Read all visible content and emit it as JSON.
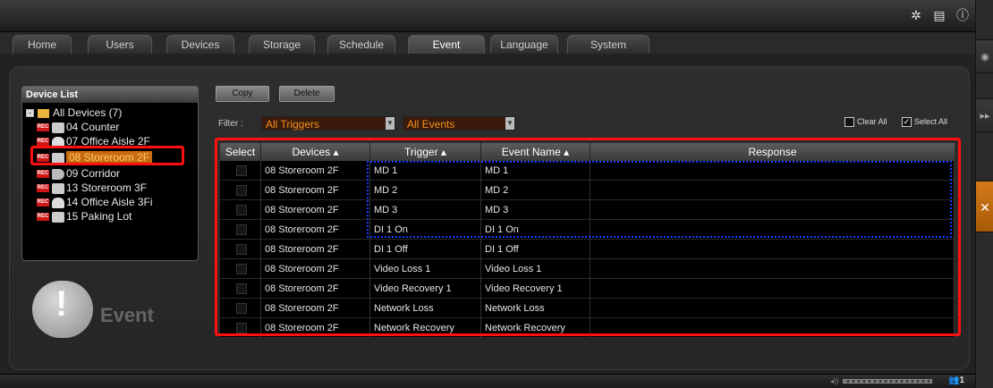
{
  "header": {
    "icons": [
      "gear-icon",
      "document-icon",
      "info-icon"
    ]
  },
  "tabs": [
    {
      "label": "Home",
      "active": false
    },
    {
      "label": "Users",
      "active": false
    },
    {
      "label": "Devices",
      "active": false
    },
    {
      "label": "Storage",
      "active": false
    },
    {
      "label": "Schedule",
      "active": false
    },
    {
      "label": "Event",
      "active": true
    },
    {
      "label": "Language",
      "active": false
    },
    {
      "label": "System",
      "active": false
    }
  ],
  "device_list": {
    "title": "Device List",
    "root": "All Devices (7)",
    "items": [
      {
        "label": "04  Counter",
        "rec": "REC",
        "icon": "camera-icon"
      },
      {
        "label": "07  Office Aisle 2F",
        "rec": "REC",
        "icon": "dome-camera-icon"
      },
      {
        "label": "08  Storeroom 2F",
        "rec": "REC",
        "icon": "camera-icon",
        "selected": true
      },
      {
        "label": "09  Corridor",
        "rec": "REC",
        "icon": "bullet-camera-icon"
      },
      {
        "label": "13  Storeroom 3F",
        "rec": "REC",
        "icon": "camera-icon"
      },
      {
        "label": "14  Office Aisle 3Fi",
        "rec": "REC",
        "icon": "dome-camera-icon"
      },
      {
        "label": "15  Paking Lot",
        "rec": "REC",
        "icon": "camera-icon"
      }
    ]
  },
  "logo": {
    "text": "Event"
  },
  "toolbar": {
    "copy": "Copy",
    "delete": "Delete"
  },
  "filter": {
    "label": "Filter :",
    "trigger_value": "All Triggers",
    "event_value": "All Events",
    "clear_all": "Clear All",
    "select_all": "Select All"
  },
  "table": {
    "headers": [
      "Select",
      "Devices ▴",
      "Trigger ▴",
      "Event Name ▴",
      "Response"
    ],
    "rows": [
      {
        "device": "08 Storeroom 2F",
        "trigger": "MD 1",
        "event": "MD 1",
        "response": ""
      },
      {
        "device": "08 Storeroom 2F",
        "trigger": "MD 2",
        "event": "MD 2",
        "response": ""
      },
      {
        "device": "08 Storeroom 2F",
        "trigger": "MD 3",
        "event": "MD 3",
        "response": ""
      },
      {
        "device": "08 Storeroom 2F",
        "trigger": "DI 1 On",
        "event": "DI 1 On",
        "response": ""
      },
      {
        "device": "08 Storeroom 2F",
        "trigger": "DI 1 Off",
        "event": "DI 1 Off",
        "response": ""
      },
      {
        "device": "08 Storeroom 2F",
        "trigger": "Video Loss 1",
        "event": "Video Loss 1",
        "response": ""
      },
      {
        "device": "08 Storeroom 2F",
        "trigger": "Video Recovery 1",
        "event": "Video Recovery 1",
        "response": ""
      },
      {
        "device": "08 Storeroom 2F",
        "trigger": "Network Loss",
        "event": "Network Loss",
        "response": ""
      },
      {
        "device": "08 Storeroom 2F",
        "trigger": "Network Recovery",
        "event": "Network Recovery",
        "response": ""
      }
    ]
  },
  "status": {
    "user_count": "1"
  },
  "colors": {
    "accent": "#f09020",
    "highlight": "#ff1010",
    "selection": "#1a3cff"
  }
}
